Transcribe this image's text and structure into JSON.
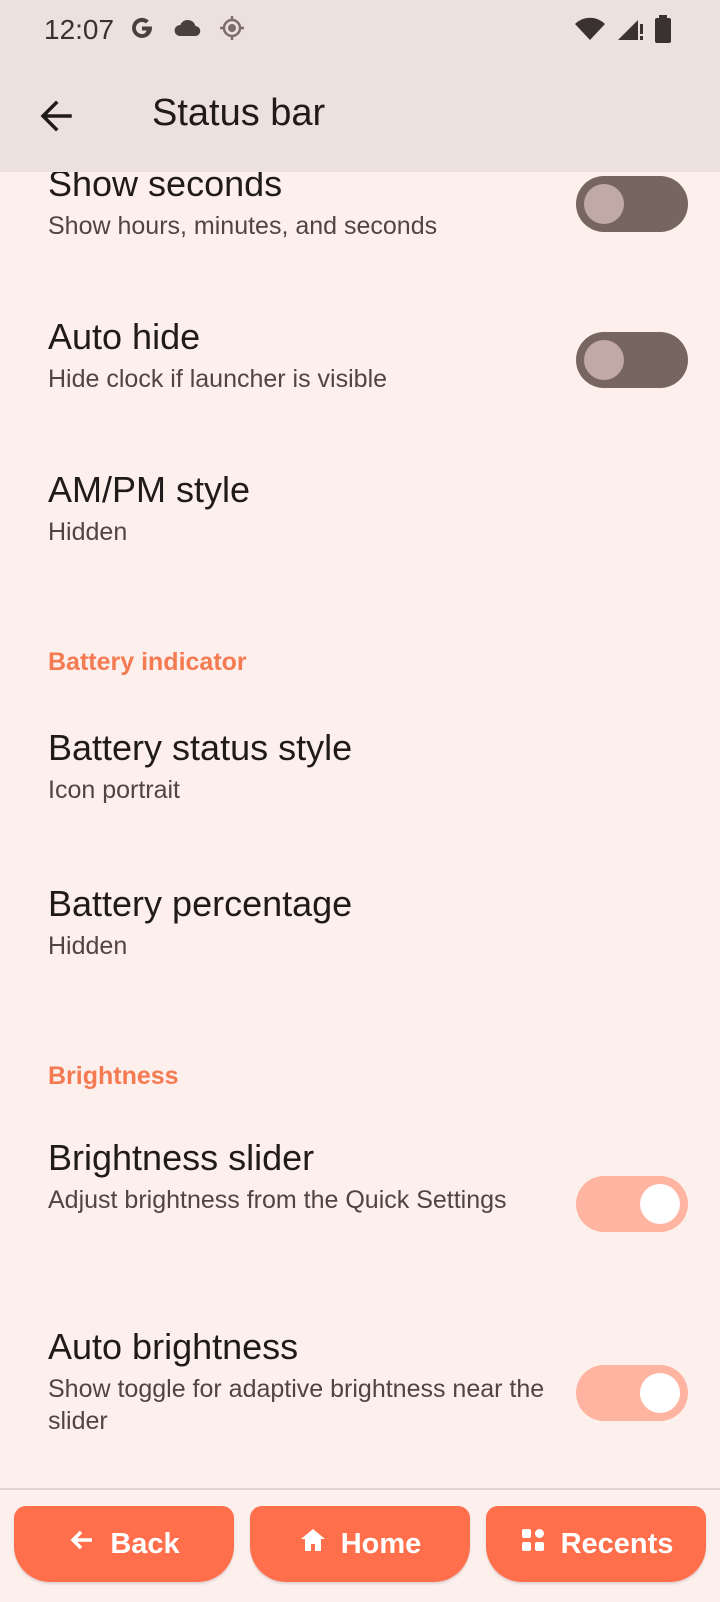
{
  "status_bar": {
    "time": "12:07",
    "icons_left": [
      "google-icon",
      "cloud-icon",
      "location-icon"
    ],
    "icons_right": [
      "wifi-icon",
      "signal-icon",
      "battery-icon"
    ]
  },
  "app_bar": {
    "title": "Status bar",
    "back_icon": "back-arrow-icon"
  },
  "settings": {
    "show_seconds": {
      "title": "Show seconds",
      "summary": "Show hours, minutes, and seconds",
      "enabled": false
    },
    "auto_hide": {
      "title": "Auto hide",
      "summary": "Hide clock if launcher is visible",
      "enabled": false
    },
    "ampm_style": {
      "title": "AM/PM style",
      "summary": "Hidden"
    },
    "battery_section": "Battery indicator",
    "battery_status_style": {
      "title": "Battery status style",
      "summary": "Icon portrait"
    },
    "battery_percentage": {
      "title": "Battery percentage",
      "summary": "Hidden"
    },
    "brightness_section": "Brightness",
    "brightness_slider": {
      "title": "Brightness slider",
      "summary": "Adjust brightness from the Quick Settings",
      "enabled": true
    },
    "auto_brightness": {
      "title": "Auto brightness",
      "summary": "Show toggle for adaptive brightness near the slider",
      "enabled": true
    }
  },
  "nav": {
    "back": "Back",
    "home": "Home",
    "recents": "Recents"
  },
  "colors": {
    "accent": "#f47a52",
    "nav_button": "#ff6f4c",
    "switch_on_track": "#ffb4a1",
    "switch_off_track": "#77655f",
    "background": "#fcefec",
    "app_bar": "#ede1df"
  }
}
